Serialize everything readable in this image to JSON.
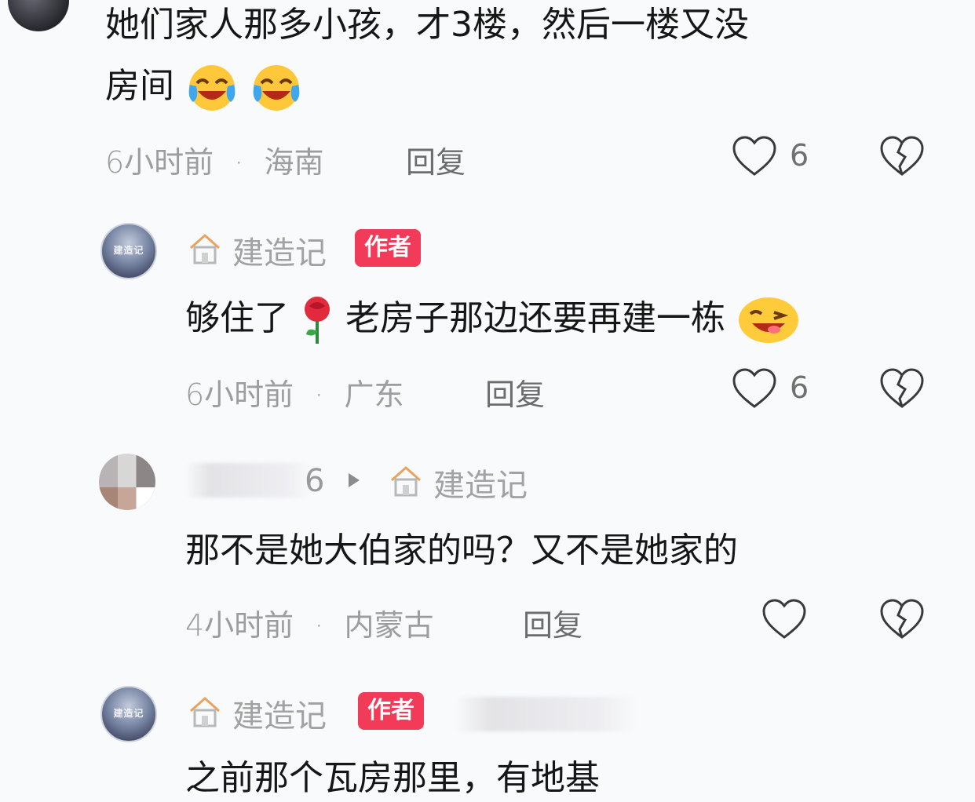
{
  "comments": [
    {
      "text_line1": "她们家人那多小孩，才3楼，然后一楼又没",
      "text_line2": "房间",
      "time": "6小时前",
      "location": "海南",
      "reply_label": "回复",
      "likes": "6",
      "emoji": [
        "crying-laughing-emoji",
        "crying-laughing-emoji"
      ]
    },
    {
      "author": "建造记",
      "badge": "作者",
      "text_a": "够住了",
      "text_b": "老房子那边还要再建一栋",
      "time": "6小时前",
      "location": "广东",
      "reply_label": "回复",
      "likes": "6",
      "emoji": [
        "rose-emoji",
        "winking-smile-emoji"
      ]
    },
    {
      "author_suffix": "6",
      "reply_to": "建造记",
      "text": "那不是她大伯家的吗？又不是她家的",
      "time": "4小时前",
      "location": "内蒙古",
      "reply_label": "回复"
    },
    {
      "author": "建造记",
      "badge": "作者",
      "text": "之前那个瓦房那里，有地基"
    }
  ],
  "separator": "·",
  "avatar_stamp": "建造记",
  "colors": {
    "background": "#f9fafb",
    "badge": "#f23a59",
    "meta": "#9d9d9d"
  }
}
